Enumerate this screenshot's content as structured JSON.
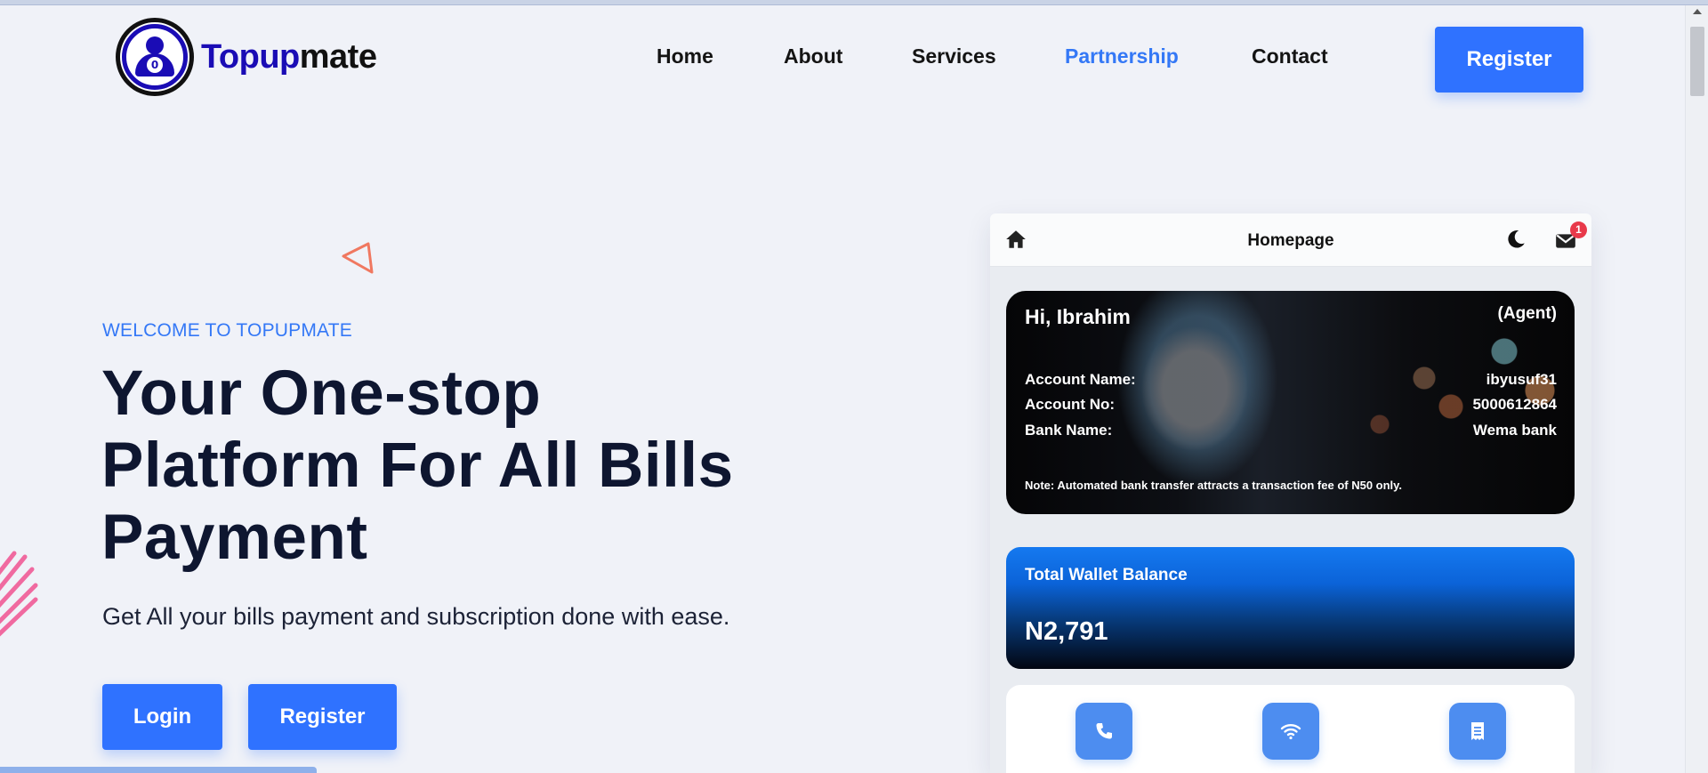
{
  "brand": {
    "name_part1": "Topup",
    "name_part2": "mate",
    "logo_coin": "0",
    "accent": "#2f72ff",
    "dark_blue": "#1a0cb5"
  },
  "nav": {
    "items": [
      {
        "label": "Home"
      },
      {
        "label": "About"
      },
      {
        "label": "Services"
      },
      {
        "label": "Partnership",
        "active": true
      },
      {
        "label": "Contact"
      }
    ],
    "register_label": "Register"
  },
  "hero": {
    "welcome": "WELCOME TO TOPUPMATE",
    "headline_line1": "Your One-stop",
    "headline_line2": "Platform For All Bills",
    "headline_line3": "Payment",
    "subtext": "Get All your bills payment and subscription done with ease.",
    "login_label": "Login",
    "register_label": "Register"
  },
  "phone": {
    "title": "Homepage",
    "notification_count": "1",
    "greeting": "Hi, Ibrahim",
    "role": "(Agent)",
    "account": {
      "name_label": "Account Name:",
      "name_value": "ibyusuf31",
      "number_label": "Account No:",
      "number_value": "5000612864",
      "bank_label": "Bank Name:",
      "bank_value": "Wema bank"
    },
    "note": "Note: Automated bank transfer attracts a transaction fee of N50 only.",
    "wallet_label": "Total Wallet Balance",
    "wallet_amount": "N2,791",
    "services": [
      {
        "icon": "phone-icon"
      },
      {
        "icon": "wifi-icon"
      },
      {
        "icon": "receipt-icon"
      }
    ]
  }
}
